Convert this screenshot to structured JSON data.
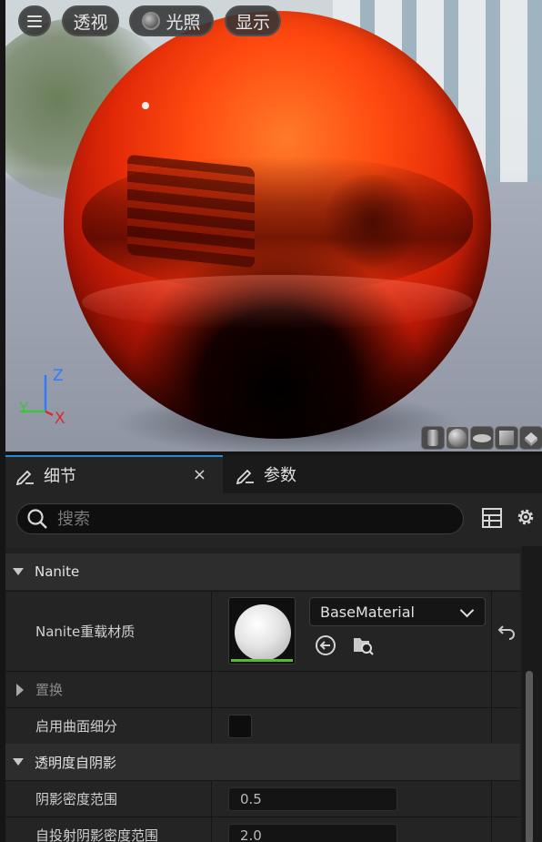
{
  "viewport": {
    "menu_icon": "hamburger-icon",
    "perspective_label": "透视",
    "lighting_label": "光照",
    "show_label": "显示",
    "axis": {
      "z": "Z",
      "y": "Y",
      "x": "X"
    },
    "axis_colors": {
      "z": "#2f7bff",
      "y": "#3ec33e",
      "x": "#e02a2a"
    },
    "preview_shapes": [
      "cylinder-icon",
      "sphere-icon",
      "plane-icon",
      "cube-icon",
      "custom-mesh-icon"
    ]
  },
  "tabs": {
    "details_label": "细节",
    "details_close": "×",
    "params_label": "参数"
  },
  "search": {
    "placeholder": "搜索",
    "value": ""
  },
  "properties": {
    "nanite_category": "Nanite",
    "nanite_override_label": "Nanite重载材质",
    "material_value": "BaseMaterial",
    "replace_label": "置换",
    "tessellation_label": "启用曲面细分",
    "tessellation_checked": false,
    "translucency_category": "透明度自阴影",
    "shadow_density_label": "阴影密度范围",
    "shadow_density_value": "0.5",
    "self_shadow_density_label": "自投射阴影密度范围",
    "self_shadow_density_value": "2.0"
  },
  "colors": {
    "accent_tab": "#2d86d1",
    "thumbnail_bar": "#58b935",
    "sphere": "#ff4a10"
  }
}
